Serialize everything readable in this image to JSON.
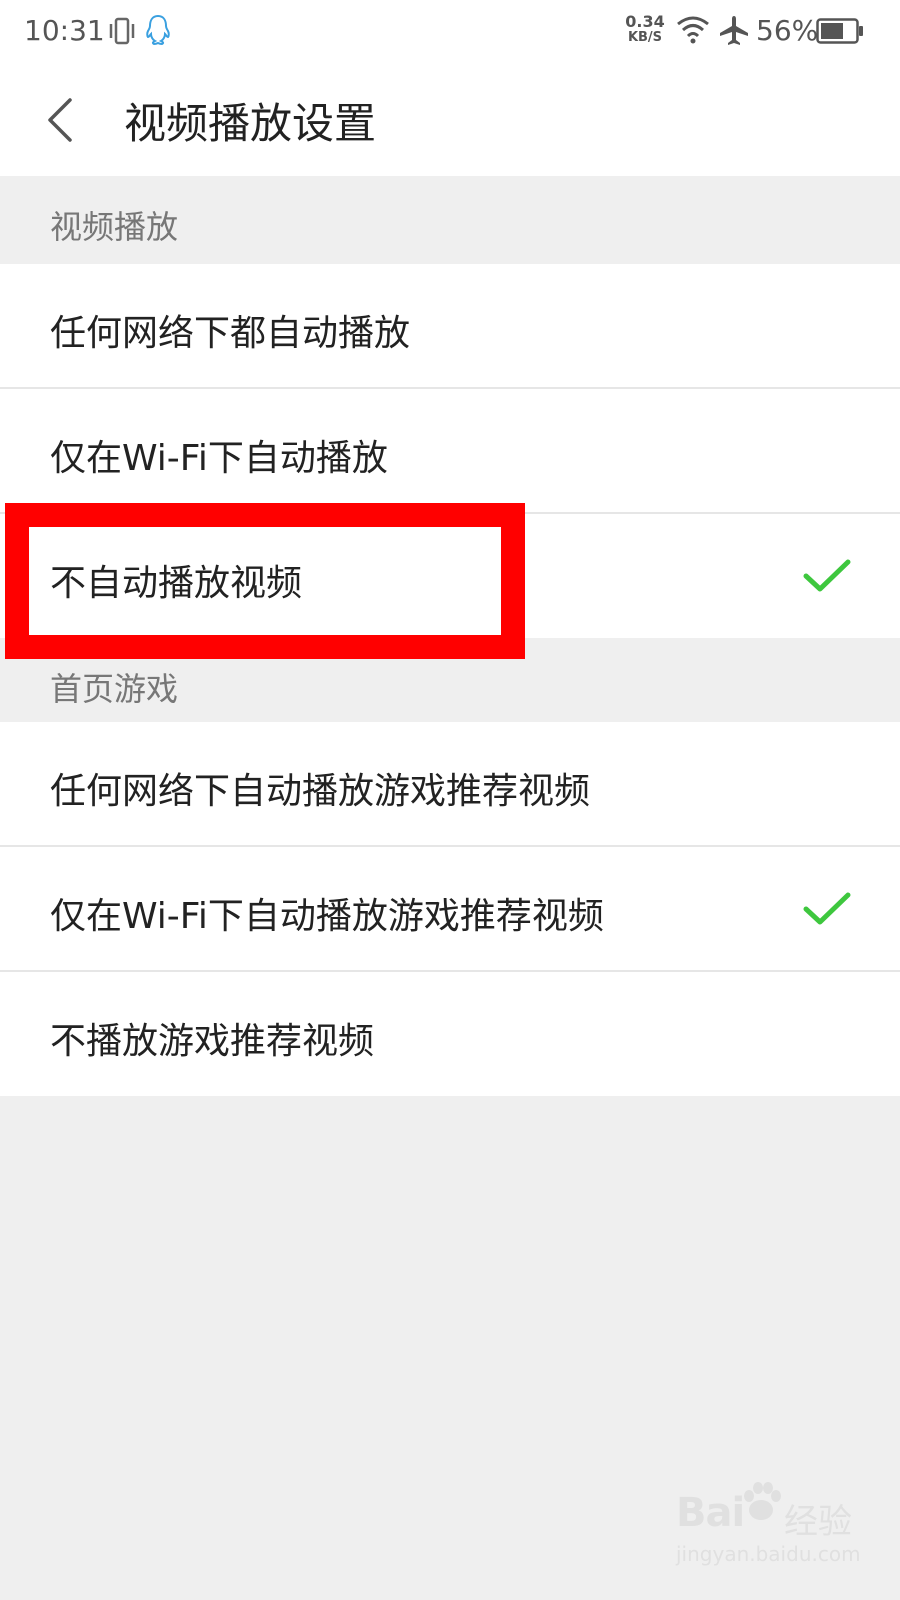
{
  "status_bar": {
    "time": "10:31",
    "net_speed_value": "0.34",
    "net_speed_unit": "KB/S",
    "battery_percent": "56%"
  },
  "header": {
    "title": "视频播放设置"
  },
  "sections": [
    {
      "label": "视频播放",
      "items": [
        {
          "label": "任何网络下都自动播放",
          "selected": false
        },
        {
          "label": "仅在Wi-Fi下自动播放",
          "selected": false
        },
        {
          "label": "不自动播放视频",
          "selected": true
        }
      ]
    },
    {
      "label": "首页游戏",
      "items": [
        {
          "label": "任何网络下自动播放游戏推荐视频",
          "selected": false
        },
        {
          "label": "仅在Wi-Fi下自动播放游戏推荐视频",
          "selected": true
        },
        {
          "label": "不播放游戏推荐视频",
          "selected": false
        }
      ]
    }
  ],
  "icons": {
    "back": "chevron-left-icon",
    "check": "check-icon",
    "vibrate": "vibrate-icon",
    "qq": "qq-penguin-icon",
    "wifi": "wifi-icon",
    "airplane": "airplane-icon",
    "battery": "battery-icon"
  },
  "colors": {
    "check": "#3ec73e",
    "highlight": "#ff0000",
    "background": "#efefef",
    "qq_icon": "#3aa0e0"
  },
  "watermark": {
    "logo": "Bai",
    "logo_tail": "经验",
    "url": "jingyan.baidu.com"
  }
}
